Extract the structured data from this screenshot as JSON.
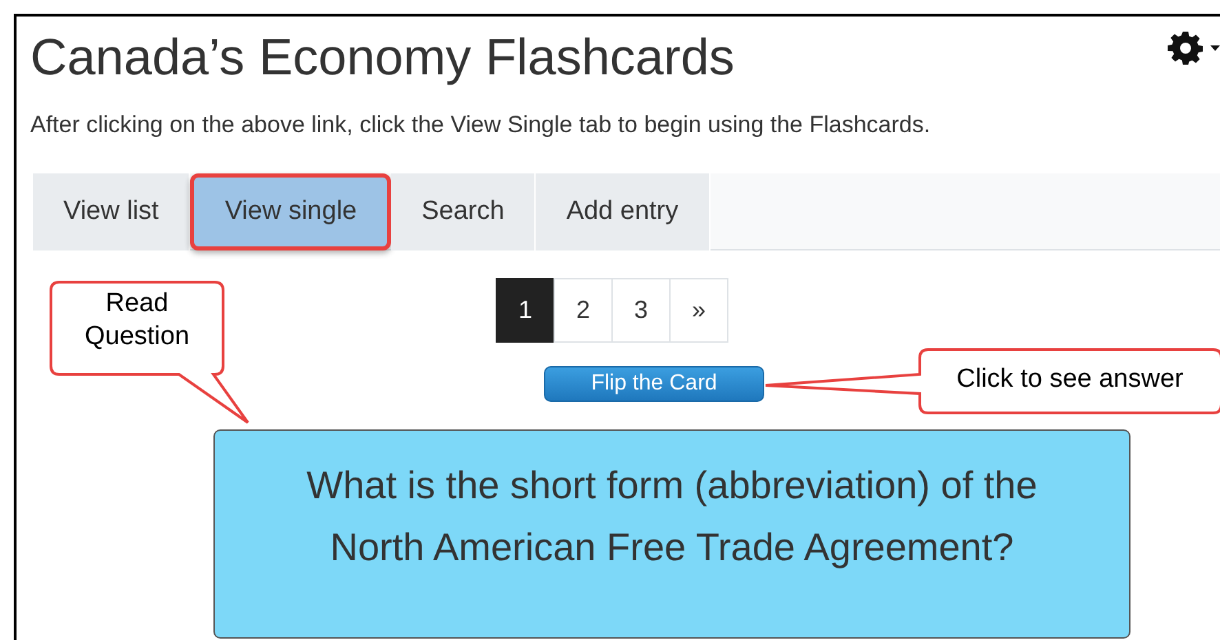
{
  "page": {
    "title": "Canada’s Economy Flashcards",
    "intro": "After clicking on the above link, click the View Single tab to begin using the Flashcards."
  },
  "tabs": [
    {
      "label": "View list",
      "selected": false
    },
    {
      "label": "View single",
      "selected": true
    },
    {
      "label": "Search",
      "selected": false
    },
    {
      "label": "Add entry",
      "selected": false
    }
  ],
  "pagination": [
    {
      "label": "1",
      "selected": true
    },
    {
      "label": "2",
      "selected": false
    },
    {
      "label": "3",
      "selected": false
    },
    {
      "label": "»",
      "selected": false
    }
  ],
  "flip_button": "Flip the Card",
  "card": {
    "question": "What is the short form (abbreviation) of the North American Free Trade Agreement?"
  },
  "callouts": [
    {
      "kind": "tail-down",
      "text": "Read Question"
    },
    {
      "kind": "tail-left",
      "text": "Click to see answer"
    }
  ]
}
